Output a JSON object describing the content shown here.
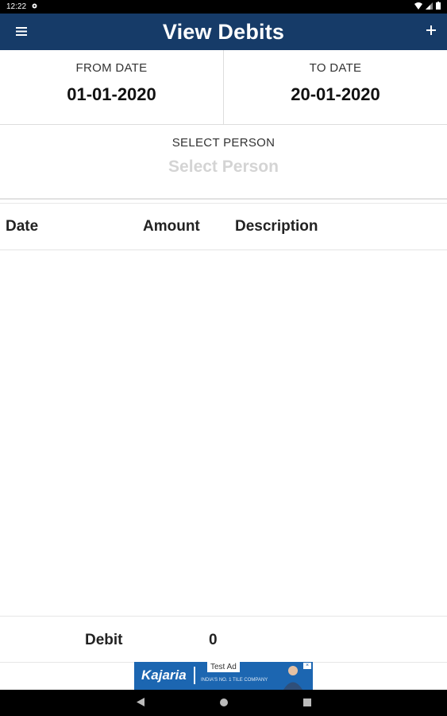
{
  "status": {
    "time": "12:22"
  },
  "app": {
    "title": "View Debits"
  },
  "dates": {
    "from_label": "FROM DATE",
    "from_value": "01-01-2020",
    "to_label": "TO DATE",
    "to_value": "20-01-2020"
  },
  "person": {
    "label": "SELECT PERSON",
    "placeholder": "Select Person"
  },
  "table": {
    "headers": [
      "Date",
      "Amount",
      "Description"
    ],
    "rows": []
  },
  "summary": {
    "label": "Debit",
    "value": "0"
  },
  "ad": {
    "brand": "Kajaria",
    "tag": "Test Ad",
    "subtitle": "INDIA'S NO. 1 TILE COMPANY"
  },
  "colors": {
    "appbar": "#163b68",
    "ad_bg": "#1c66b1"
  }
}
